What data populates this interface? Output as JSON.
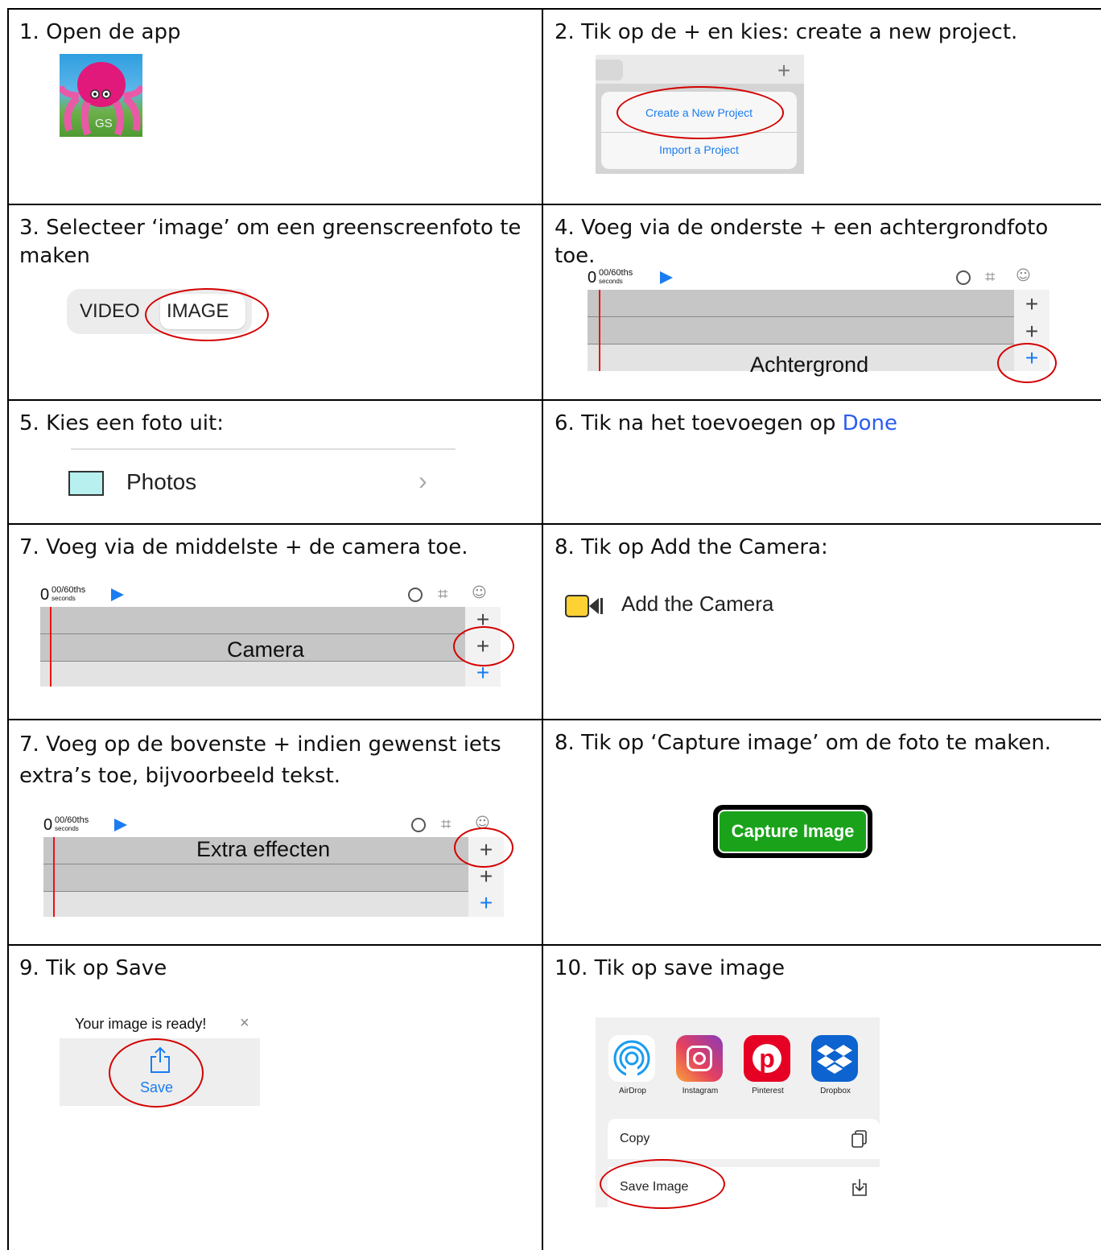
{
  "cells": {
    "c1": {
      "title": "1. Open de app",
      "icon_text": "GS"
    },
    "c2": {
      "title": "2. Tik op de + en kies: create a new project.",
      "menu": [
        "Create a New Project",
        "Import a Project"
      ],
      "plus": "+"
    },
    "c3": {
      "title": "3. Selecteer ‘image’ om een greenscreenfoto te maken",
      "toggle": [
        "VIDEO",
        "IMAGE"
      ]
    },
    "c4": {
      "title": "4. Voeg via de onderste + een achtergrondfoto toe.",
      "lane_label": "Achtergrond"
    },
    "c5": {
      "title": "5. Kies een foto uit:",
      "item": "Photos",
      "chevron": "›"
    },
    "c6": {
      "title_prefix": "6. Tik na het toevoegen op ",
      "title_link": "Done"
    },
    "c7": {
      "title": "7. Voeg via de middelste + de camera toe.",
      "lane_label": "Camera"
    },
    "c8": {
      "title": "8. Tik op Add the Camera:",
      "item": "Add the Camera"
    },
    "c9": {
      "title": "7. Voeg op de bovenste + indien gewenst iets extra’s toe, bijvoorbeeld tekst.",
      "lane_label": "Extra effecten"
    },
    "c10": {
      "title": "8. Tik op ‘Capture image’ om de foto te maken.",
      "button": "Capture Image"
    },
    "c11": {
      "title": "9.  Tik op Save",
      "toast": "Your image is ready!",
      "close": "×",
      "save": "Save"
    },
    "c12": {
      "title": "10. Tik op save image",
      "apps": [
        {
          "label": "AirDrop"
        },
        {
          "label": "Instagram"
        },
        {
          "label": "Pinterest"
        },
        {
          "label": "Dropbox"
        }
      ],
      "actions": [
        "Copy",
        "Save Image"
      ]
    }
  },
  "timeline": {
    "count": "0",
    "frac": "00/60ths",
    "unit": "seconds",
    "plus": "+"
  },
  "colors": {
    "accent": "#1a7cf0",
    "highlight": "#d40000",
    "capture_green": "#1aa31a",
    "done_blue": "#2b5cf0"
  }
}
